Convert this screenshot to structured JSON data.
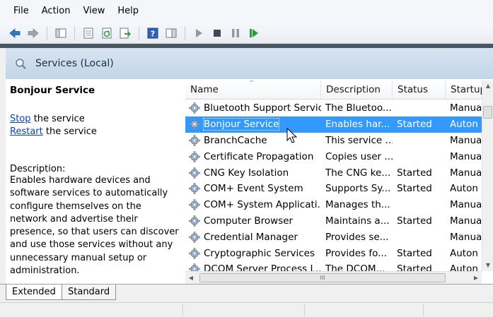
{
  "menu": [
    "File",
    "Action",
    "View",
    "Help"
  ],
  "header": {
    "title": "Services (Local)"
  },
  "detail": {
    "service_name": "Bonjour Service",
    "stop_link": "Stop",
    "stop_suffix": " the service",
    "restart_link": "Restart",
    "restart_suffix": " the service",
    "description_label": "Description:",
    "description": "Enables hardware devices and software services to automatically configure themselves on the network and advertise their presence, so that users can discover and use those services without any unnecessary manual setup or administration."
  },
  "table": {
    "columns": [
      "Name",
      "Description",
      "Status",
      "Startup"
    ],
    "sort_indicator": "^",
    "rows": [
      {
        "name": "Bluetooth Support Service",
        "description": "The Bluetoo...",
        "status": "",
        "startup": "Manua"
      },
      {
        "name": "Bonjour Service",
        "description": "Enables har...",
        "status": "Started",
        "startup": "Auton",
        "selected": true
      },
      {
        "name": "BranchCache",
        "description": "This service ...",
        "status": "",
        "startup": "Manua"
      },
      {
        "name": "Certificate Propagation",
        "description": "Copies user ...",
        "status": "",
        "startup": "Manua"
      },
      {
        "name": "CNG Key Isolation",
        "description": "The CNG ke...",
        "status": "Started",
        "startup": "Manua"
      },
      {
        "name": "COM+ Event System",
        "description": "Supports Sy...",
        "status": "Started",
        "startup": "Auton"
      },
      {
        "name": "COM+ System Applicati...",
        "description": "Manages th...",
        "status": "",
        "startup": "Manua"
      },
      {
        "name": "Computer Browser",
        "description": "Maintains a...",
        "status": "Started",
        "startup": "Manua"
      },
      {
        "name": "Credential Manager",
        "description": "Provides se...",
        "status": "",
        "startup": "Manua"
      },
      {
        "name": "Cryptographic Services",
        "description": "Provides fo...",
        "status": "Started",
        "startup": "Auton"
      },
      {
        "name": "DCOM Server Process L...",
        "description": "The DCOM...",
        "status": "Started",
        "startup": "Auton"
      }
    ]
  },
  "tabs": {
    "extended": "Extended",
    "standard": "Standard"
  },
  "scroll": {
    "hthumb_grip": "III"
  },
  "colors": {
    "selection": "#3399ff",
    "link": "#0645ad",
    "header_band": "#c3d5e9"
  }
}
